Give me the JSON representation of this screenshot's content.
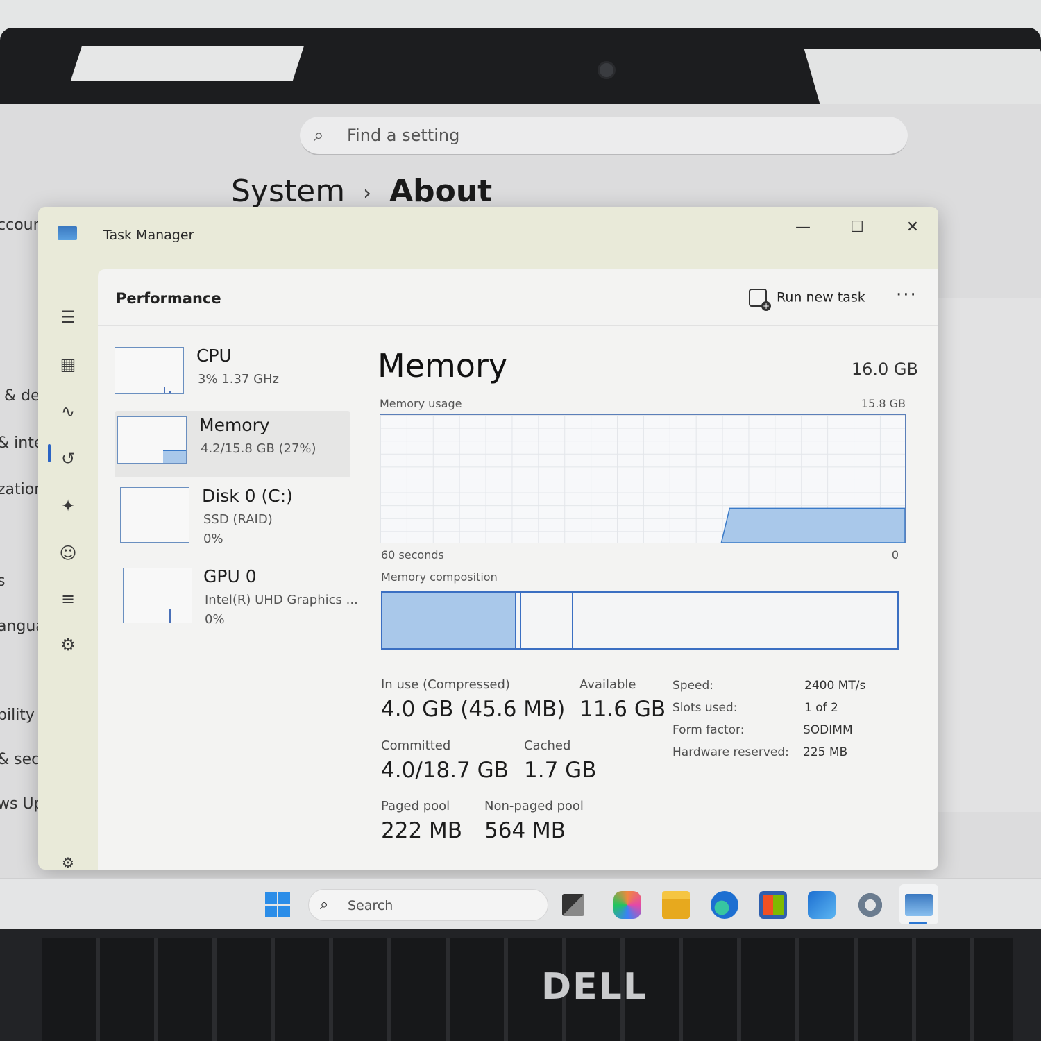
{
  "settings": {
    "search_placeholder": "Find a setting",
    "breadcrumb_parent": "System",
    "breadcrumb_separator": "›",
    "breadcrumb_current": "About",
    "sidebar_fragments": [
      "ccoun",
      "& dev",
      "& inter",
      "zation",
      "s",
      "anguag",
      "bility",
      "& securi",
      "ws Updat"
    ]
  },
  "task_manager": {
    "title": "Task Manager",
    "window_buttons": {
      "minimize": "—",
      "maximize": "☐",
      "close": "✕"
    },
    "section": "Performance",
    "run_new_task": "Run new task",
    "more": "···",
    "devices": [
      {
        "name": "CPU",
        "sub1": "3%  1.37 GHz",
        "sub2": ""
      },
      {
        "name": "Memory",
        "sub1": "4.2/15.8 GB (27%)",
        "sub2": ""
      },
      {
        "name": "Disk 0 (C:)",
        "sub1": "SSD (RAID)",
        "sub2": "0%"
      },
      {
        "name": "GPU 0",
        "sub1": "Intel(R) UHD Graphics ...",
        "sub2": "0%"
      }
    ],
    "memory": {
      "heading": "Memory",
      "total": "16.0 GB",
      "usage_label": "Memory usage",
      "usage_max": "15.8 GB",
      "time_left": "60 seconds",
      "time_right": "0",
      "usage_fraction": 0.27,
      "composition_label": "Memory composition",
      "composition": {
        "in_use_fraction": 0.26,
        "modified_fraction": 0.01,
        "standby_fraction": 0.1
      },
      "stats": {
        "in_use_label": "In use (Compressed)",
        "in_use_value": "4.0 GB (45.6 MB)",
        "available_label": "Available",
        "available_value": "11.6 GB",
        "committed_label": "Committed",
        "committed_value": "4.0/18.7 GB",
        "cached_label": "Cached",
        "cached_value": "1.7 GB",
        "paged_label": "Paged pool",
        "paged_value": "222 MB",
        "nonpaged_label": "Non-paged pool",
        "nonpaged_value": "564 MB"
      },
      "specs": [
        {
          "label": "Speed:",
          "value": "2400 MT/s"
        },
        {
          "label": "Slots used:",
          "value": "1 of 2"
        },
        {
          "label": "Form factor:",
          "value": "SODIMM"
        },
        {
          "label": "Hardware reserved:",
          "value": "225 MB"
        }
      ]
    }
  },
  "taskbar": {
    "search_placeholder": "Search",
    "apps": [
      "task-view-icon",
      "copilot-icon",
      "file-explorer-icon",
      "edge-icon",
      "store-icon",
      "outlook-icon",
      "settings-icon",
      "task-manager-icon"
    ]
  },
  "brand": {
    "logo_text": "DELL"
  },
  "colors": {
    "accent": "#2b64c4",
    "graph_fill": "#a9c8ea",
    "graph_line": "#3a7ac8"
  }
}
